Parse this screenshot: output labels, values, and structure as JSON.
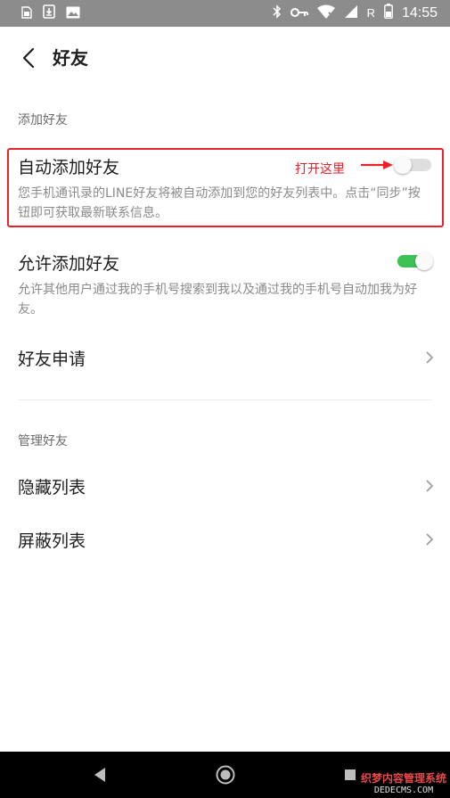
{
  "status_bar": {
    "time": "14:55",
    "network_letter": "R",
    "icons": [
      "sim-card-icon",
      "download-icon",
      "image-icon",
      "bluetooth-icon",
      "key-icon",
      "wifi-icon",
      "signal-icon",
      "battery-icon"
    ]
  },
  "header": {
    "title": "好友",
    "back_icon": "chevron-left-icon"
  },
  "sections": {
    "add_friends": {
      "title": "添加好友"
    },
    "manage_friends": {
      "title": "管理好友"
    }
  },
  "settings": {
    "auto_add": {
      "label": "自动添加好友",
      "description": "您手机通讯录的LINE好友将被自动添加到您的好友列表中。点击“同步”按钮即可获取最新联系信息。",
      "enabled": false
    },
    "allow_add": {
      "label": "允许添加好友",
      "description": "允许其他用户通过我的手机号搜索到我以及通过我的手机号自动加我为好友。",
      "enabled": true
    },
    "friend_requests": {
      "label": "好友申请"
    },
    "hidden_list": {
      "label": "隐藏列表"
    },
    "blocked_list": {
      "label": "屏蔽列表"
    }
  },
  "annotation": {
    "text": "打开这里",
    "color": "#e8212a"
  },
  "colors": {
    "toggle_on": "#3cc154",
    "toggle_off": "#dedede",
    "highlight": "#e8212a"
  },
  "watermark": {
    "line1": "织梦内容管理系统",
    "line2": "DEDECMS.COM"
  }
}
